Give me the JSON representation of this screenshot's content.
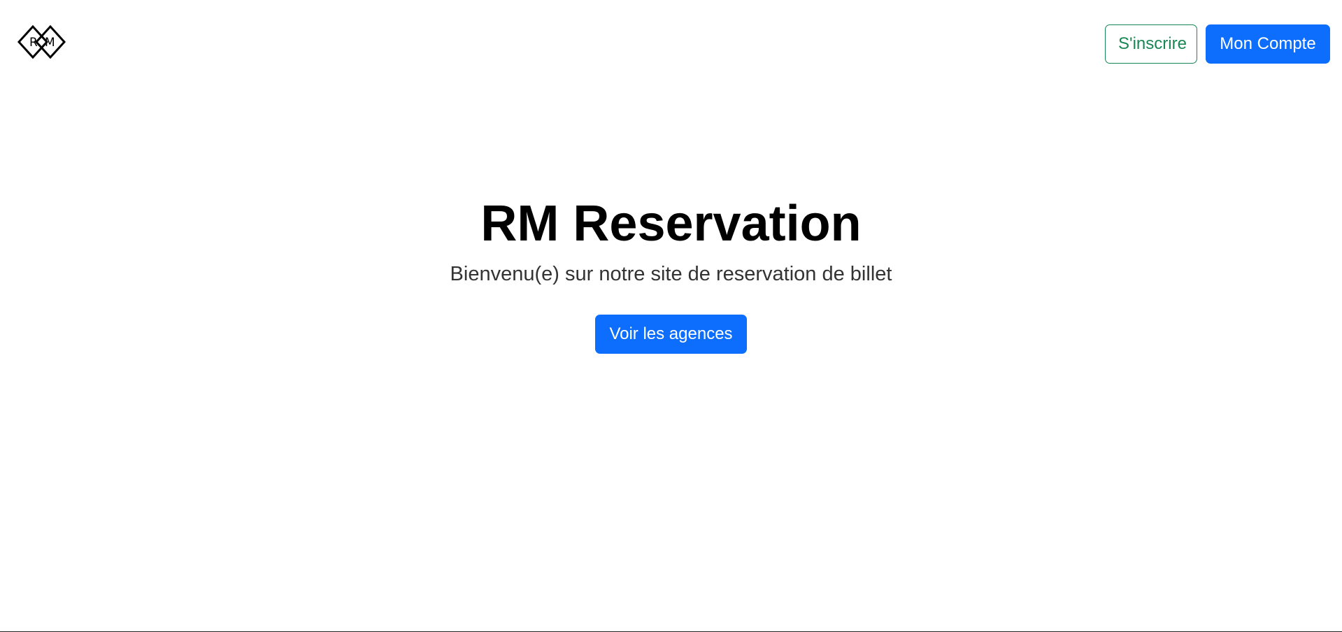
{
  "header": {
    "logo_icon": "rm-diamond-logo-icon",
    "logo_text": "RM",
    "signup_label": "S'inscrire",
    "account_label": "Mon Compte"
  },
  "hero": {
    "title": "RM Reservation",
    "subtitle": "Bienvenu(e) sur notre site de reservation de billet",
    "cta_label": "Voir les agences"
  },
  "colors": {
    "primary": "#0d6efd",
    "success": "#198754",
    "text": "#000000",
    "subtitle_text": "#333333",
    "background": "#ffffff"
  }
}
